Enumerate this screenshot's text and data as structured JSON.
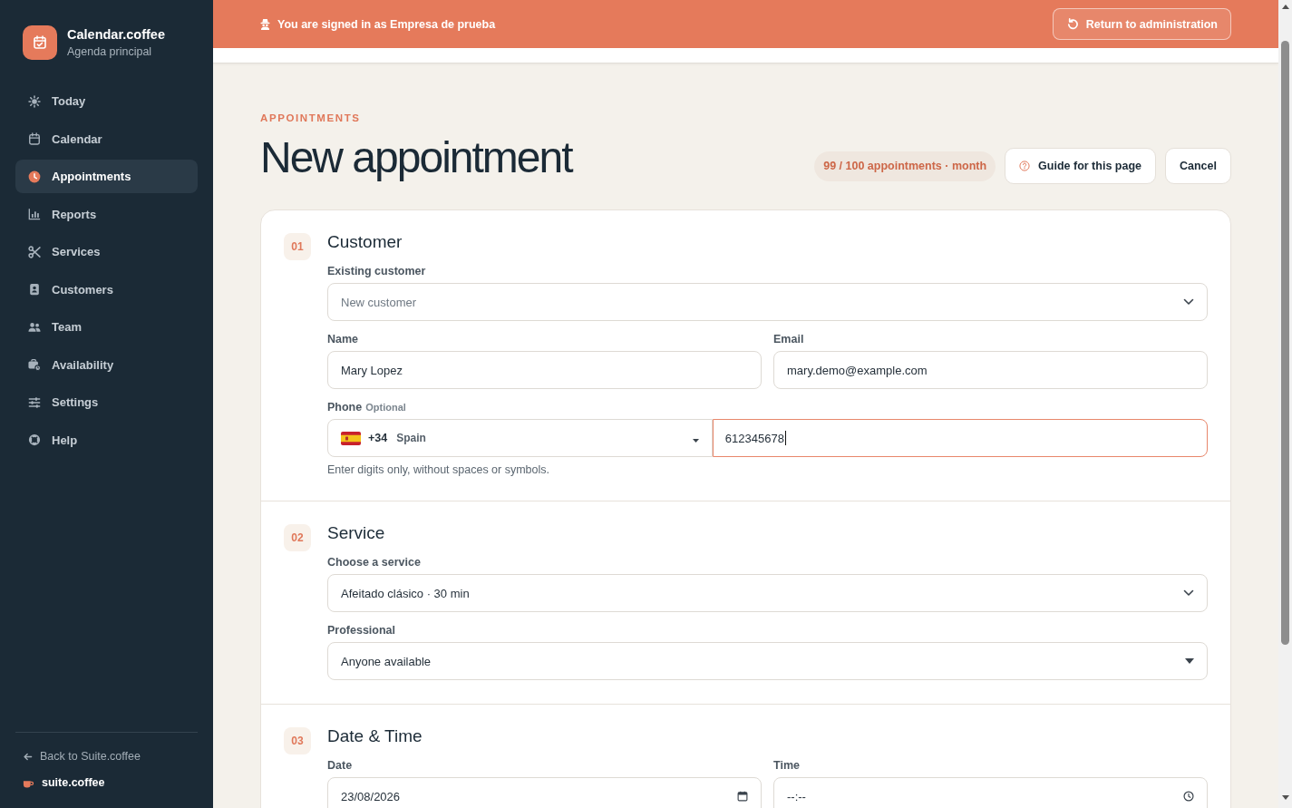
{
  "banner": {
    "message": "You are signed in as Empresa de prueba",
    "button": "Return to administration"
  },
  "sidebar": {
    "brand": {
      "name": "Calendar.coffee",
      "subtitle": "Agenda principal"
    },
    "nav_items": [
      {
        "label": "Today",
        "selected": false
      },
      {
        "label": "Calendar",
        "selected": false
      },
      {
        "label": "Appointments",
        "selected": true
      },
      {
        "label": "Reports",
        "selected": false
      },
      {
        "label": "Services",
        "selected": false
      },
      {
        "label": "Customers",
        "selected": false
      },
      {
        "label": "Team",
        "selected": false
      },
      {
        "label": "Availability",
        "selected": false
      },
      {
        "label": "Settings",
        "selected": false
      },
      {
        "label": "Help",
        "selected": false
      }
    ],
    "back_link": "Back to Suite.coffee",
    "suite_brand": "suite.coffee"
  },
  "page_header": {
    "eyebrow": "APPOINTMENTS",
    "title": "New appointment",
    "quota": "99 / 100 appointments · month",
    "buttons": [
      {
        "label": "Guide for this page",
        "kind": "guide"
      },
      {
        "label": "Cancel",
        "kind": "plain"
      }
    ]
  },
  "form_sections": [
    {
      "number": "01",
      "title": "Customer",
      "rows": [
        {
          "fields": [
            {
              "kind": "select",
              "label": "Existing customer",
              "placeholder": "New customer"
            }
          ]
        },
        {
          "fields": [
            {
              "kind": "text",
              "label": "Name",
              "value": "Mary Lopez"
            },
            {
              "kind": "text",
              "label": "Email",
              "value": "mary.demo@example.com"
            }
          ]
        },
        {
          "fields": [
            {
              "kind": "phone",
              "label": "Phone",
              "note": "Optional",
              "country_code": "+34",
              "country": "Spain",
              "value": "612345678",
              "focused": true,
              "hint": "Enter digits only, without spaces or symbols."
            }
          ]
        }
      ]
    },
    {
      "number": "02",
      "title": "Service",
      "rows": [
        {
          "fields": [
            {
              "kind": "select",
              "label": "Choose a service",
              "value": "Afeitado clásico · 30 min"
            }
          ]
        },
        {
          "fields": [
            {
              "kind": "native-select",
              "label": "Professional",
              "value": "Anyone available"
            }
          ]
        }
      ]
    },
    {
      "number": "03",
      "title": "Date & Time",
      "rows": [
        {
          "fields": [
            {
              "kind": "date",
              "label": "Date",
              "value": "23/08/2026"
            },
            {
              "kind": "time",
              "label": "Time",
              "value": "--:--"
            }
          ]
        }
      ]
    }
  ]
}
